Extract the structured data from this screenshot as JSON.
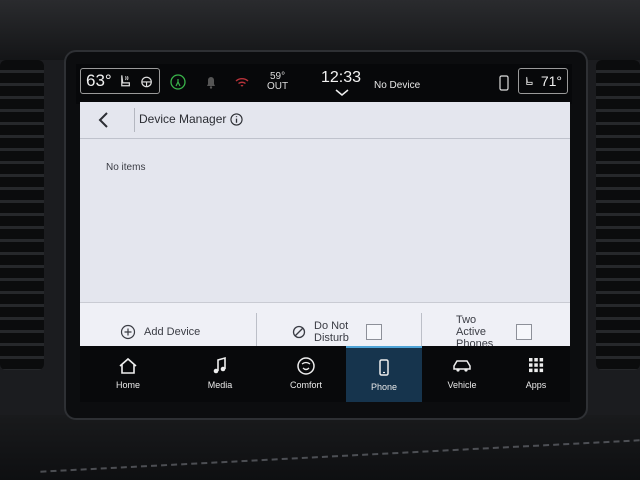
{
  "status": {
    "left_temp": "63°",
    "outside_temp": "59°",
    "outside_label": "OUT",
    "clock": "12:33",
    "device_status": "No Device",
    "right_temp": "71°"
  },
  "header": {
    "title": "Device Manager"
  },
  "content": {
    "empty_message": "No items"
  },
  "actions": {
    "add_device": "Add Device",
    "do_not_disturb": "Do Not Disturb",
    "two_active_phones": "Two Active Phones"
  },
  "nav": {
    "items": [
      {
        "label": "Home",
        "icon": "home-icon"
      },
      {
        "label": "Media",
        "icon": "music-note-icon"
      },
      {
        "label": "Comfort",
        "icon": "climate-icon"
      },
      {
        "label": "Phone",
        "icon": "phone-icon",
        "active": true
      },
      {
        "label": "Vehicle",
        "icon": "car-icon"
      },
      {
        "label": "Apps",
        "icon": "apps-grid-icon"
      }
    ]
  },
  "colors": {
    "screen_bg": "#e4e6ee",
    "nav_active": "#16344d",
    "accent": "#4ea3d6"
  }
}
